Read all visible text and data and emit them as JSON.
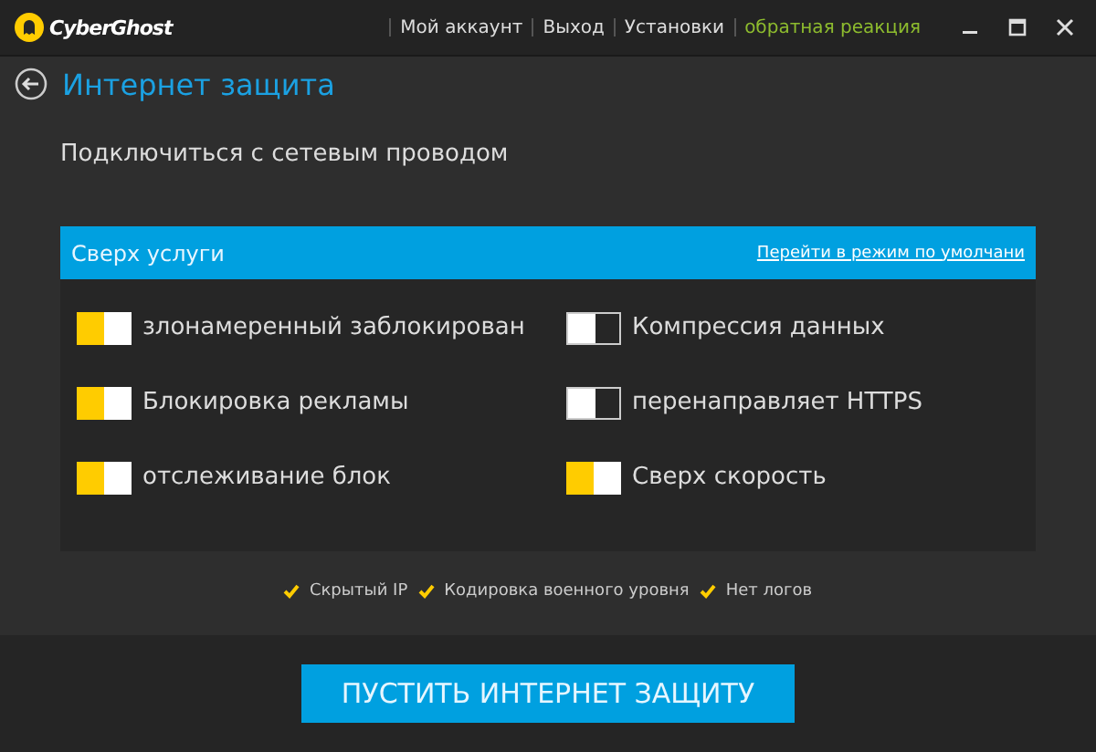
{
  "app": {
    "logo_text": "CyberGhost"
  },
  "top_menu": [
    {
      "label": "Мой аккаунт",
      "kind": "plain"
    },
    {
      "label": "Выход",
      "kind": "plain"
    },
    {
      "label": "Установки",
      "kind": "plain"
    },
    {
      "label": "обратная реакция",
      "kind": "accent"
    }
  ],
  "page_title": "Интернет защита",
  "subtitle": "Подключиться с сетевым проводом",
  "panel": {
    "title": "Сверх услуги",
    "link": "Перейти в режим по умолчани",
    "options": [
      {
        "label": "злонамеренный заблокирован",
        "on": true
      },
      {
        "label": "Компрессия данных",
        "on": false
      },
      {
        "label": "Блокировка рекламы",
        "on": true
      },
      {
        "label": "перенаправляет HTTPS",
        "on": false
      },
      {
        "label": "отслеживание блок",
        "on": true
      },
      {
        "label": "Сверх скорость",
        "on": true
      }
    ]
  },
  "features": [
    "Скрытый IP",
    "Кодировка военного уровня",
    "Нет логов"
  ],
  "start_button": "ПУСТИТЬ ИНТЕРНЕТ ЗАЩИТУ"
}
